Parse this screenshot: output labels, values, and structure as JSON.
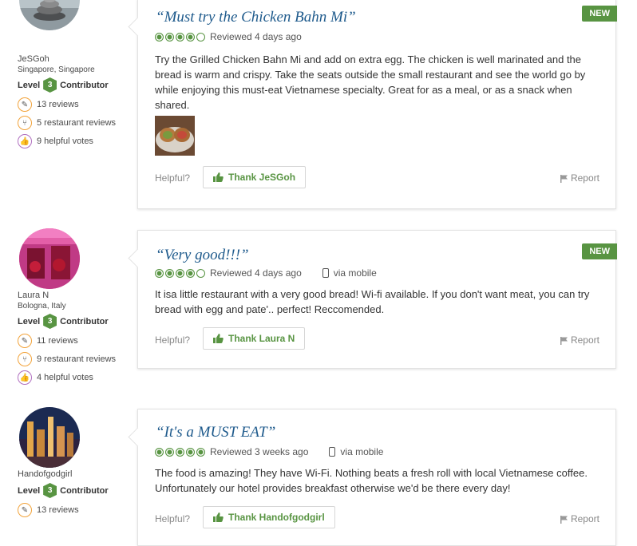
{
  "reviews": [
    {
      "user": {
        "name": "JeSGoh",
        "location": "Singapore, Singapore",
        "level_label": "Level",
        "level": "3",
        "contributor_label": "Contributor",
        "reviews": "13 reviews",
        "restaurant_reviews": "5 restaurant reviews",
        "helpful_votes": "9 helpful votes"
      },
      "title": "“Must try the Chicken Bahn Mi”",
      "rating_bubbles": 4,
      "reviewed": "Reviewed 4 days ago",
      "via_mobile": "",
      "badge": "NEW",
      "text": "Try the Grilled Chicken Bahn Mi and add on extra egg. The chicken is well marinated and the bread is warm and crispy. Take the seats outside the small restaurant and see the world go by while enjoying this must-eat Vietnamese specialty. Great for as a meal, or as a snack when shared.",
      "helpful_label": "Helpful?",
      "thank_label": "Thank JeSGoh",
      "report_label": "Report"
    },
    {
      "user": {
        "name": "Laura N",
        "location": "Bologna, Italy",
        "level_label": "Level",
        "level": "3",
        "contributor_label": "Contributor",
        "reviews": "11 reviews",
        "restaurant_reviews": "9 restaurant reviews",
        "helpful_votes": "4 helpful votes"
      },
      "title": "“Very good!!!”",
      "rating_bubbles": 4,
      "reviewed": "Reviewed 4 days ago",
      "via_mobile": "via mobile",
      "badge": "NEW",
      "text": "It isa little restaurant with a very good bread! Wi-fi available. If you don't want meat, you can try bread with egg and pate'.. perfect! Reccomended.",
      "helpful_label": "Helpful?",
      "thank_label": "Thank Laura N",
      "report_label": "Report"
    },
    {
      "user": {
        "name": "Handofgodgirl",
        "location": "",
        "level_label": "Level",
        "level": "3",
        "contributor_label": "Contributor",
        "reviews": "13 reviews",
        "restaurant_reviews": "",
        "helpful_votes": ""
      },
      "title": "“It's a MUST EAT”",
      "rating_bubbles": 5,
      "reviewed": "Reviewed 3 weeks ago",
      "via_mobile": "via mobile",
      "badge": "",
      "text": "The food is amazing! They have Wi-Fi. Nothing beats a fresh roll with local Vietnamese coffee. Unfortunately our hotel provides breakfast otherwise we'd be there every day!",
      "helpful_label": "Helpful?",
      "thank_label": "Thank Handofgodgirl",
      "report_label": "Report"
    }
  ],
  "colors": {
    "accent_green": "#589442",
    "title_blue": "#1e5a8c",
    "stat_orange": "#f2a33a",
    "stat_purple": "#b06fbf"
  }
}
